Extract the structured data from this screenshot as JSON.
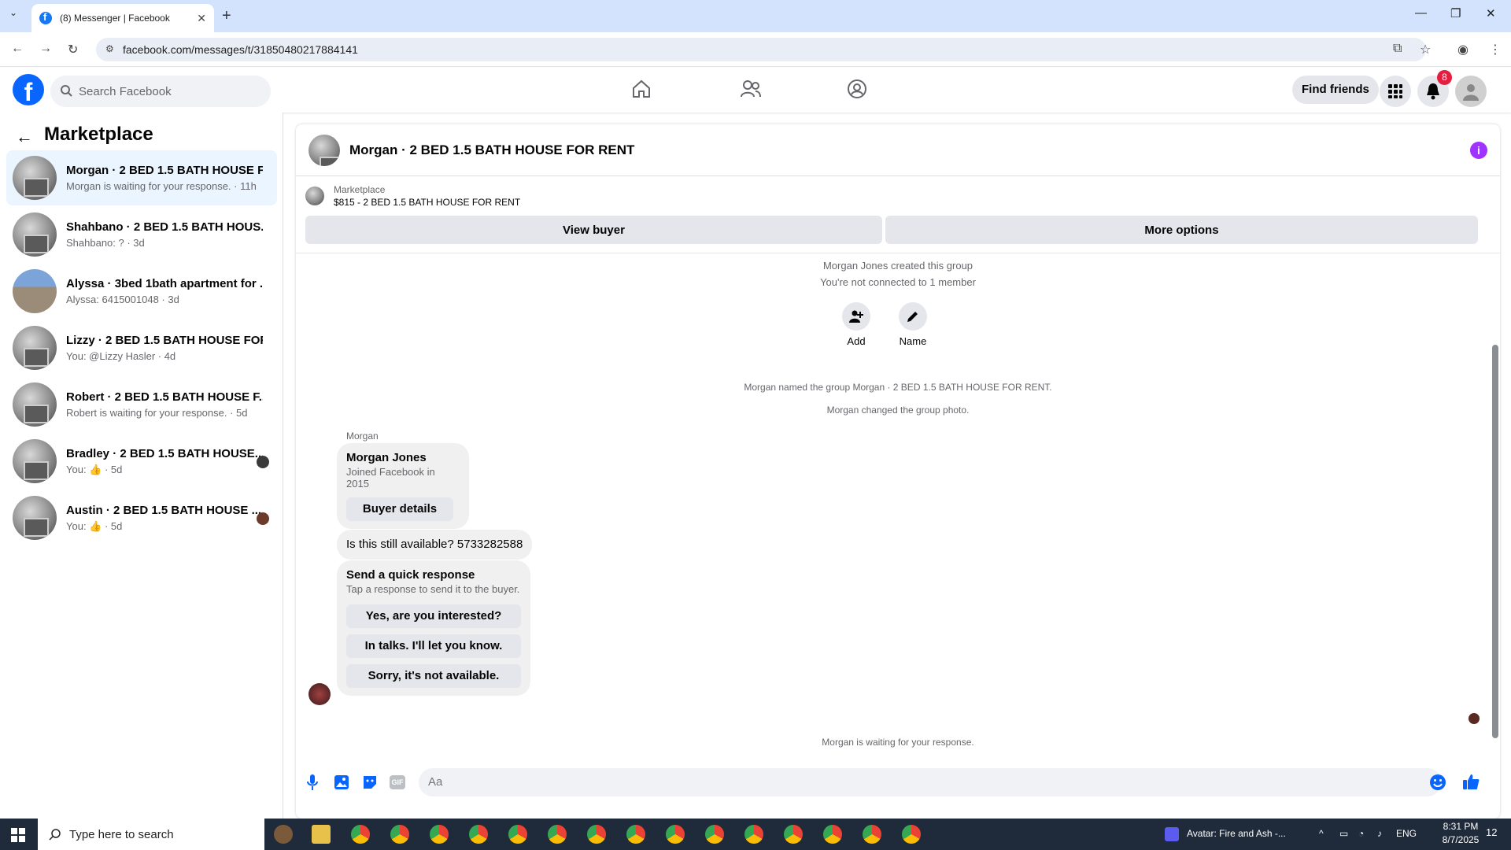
{
  "browser": {
    "tab_title": "(8) Messenger | Facebook",
    "url": "facebook.com/messages/t/31850480217884141"
  },
  "header": {
    "search_placeholder": "Search Facebook",
    "find_friends": "Find friends",
    "notification_count": "8"
  },
  "sidebar": {
    "title": "Marketplace",
    "items": [
      {
        "name": "Morgan · 2 BED 1.5 BATH HOUSE F...",
        "sub": "Morgan is waiting for your response. · 11h",
        "active": true
      },
      {
        "name": "Shahbano · 2 BED 1.5 BATH HOUS...",
        "sub": "Shahbano: ? · 3d"
      },
      {
        "name": "Alyssa · 3bed 1bath apartment for ...",
        "sub": "Alyssa: 6415001048 · 3d"
      },
      {
        "name": "Lizzy · 2 BED 1.5 BATH HOUSE FOR...",
        "sub": "You: @Lizzy Hasler · 4d"
      },
      {
        "name": "Robert · 2 BED 1.5 BATH HOUSE F...",
        "sub": "Robert is waiting for your response. · 5d"
      },
      {
        "name": "Bradley · 2 BED 1.5 BATH HOUSE...",
        "sub": "You: 👍 · 5d"
      },
      {
        "name": "Austin · 2 BED 1.5 BATH HOUSE ...",
        "sub": "You: 👍 · 5d"
      }
    ]
  },
  "chat": {
    "title": "Morgan · 2 BED 1.5 BATH HOUSE FOR RENT",
    "marketplace_label": "Marketplace",
    "listing": "$815 - 2 BED 1.5 BATH HOUSE FOR RENT",
    "view_buyer": "View buyer",
    "more_options": "More options",
    "created": "Morgan Jones created this group",
    "not_connected": "You're not connected to 1 member",
    "add_label": "Add",
    "name_label": "Name",
    "named_group": "Morgan named the group Morgan · 2 BED 1.5 BATH HOUSE FOR RENT.",
    "changed_photo": "Morgan changed the group photo.",
    "sender": "Morgan",
    "profile_name": "Morgan Jones",
    "profile_joined": "Joined Facebook in 2015",
    "buyer_details": "Buyer details",
    "message": "Is this still available? 5733282588",
    "quick_title": "Send a quick response",
    "quick_sub": "Tap a response to send it to the buyer.",
    "quick_1": "Yes, are you interested?",
    "quick_2": "In talks. I'll let you know.",
    "quick_3": "Sorry, it's not available.",
    "waiting": "Morgan is waiting for your response.",
    "input_placeholder": "Aa"
  },
  "taskbar": {
    "search_placeholder": "Type here to search",
    "media": "Avatar: Fire and Ash -...",
    "lang": "ENG",
    "time": "8:31 PM",
    "date": "8/7/2025",
    "notif": "12"
  },
  "colors": {
    "brand": "#0866ff",
    "accent": "#a033ff",
    "badge": "#e41e3f"
  }
}
